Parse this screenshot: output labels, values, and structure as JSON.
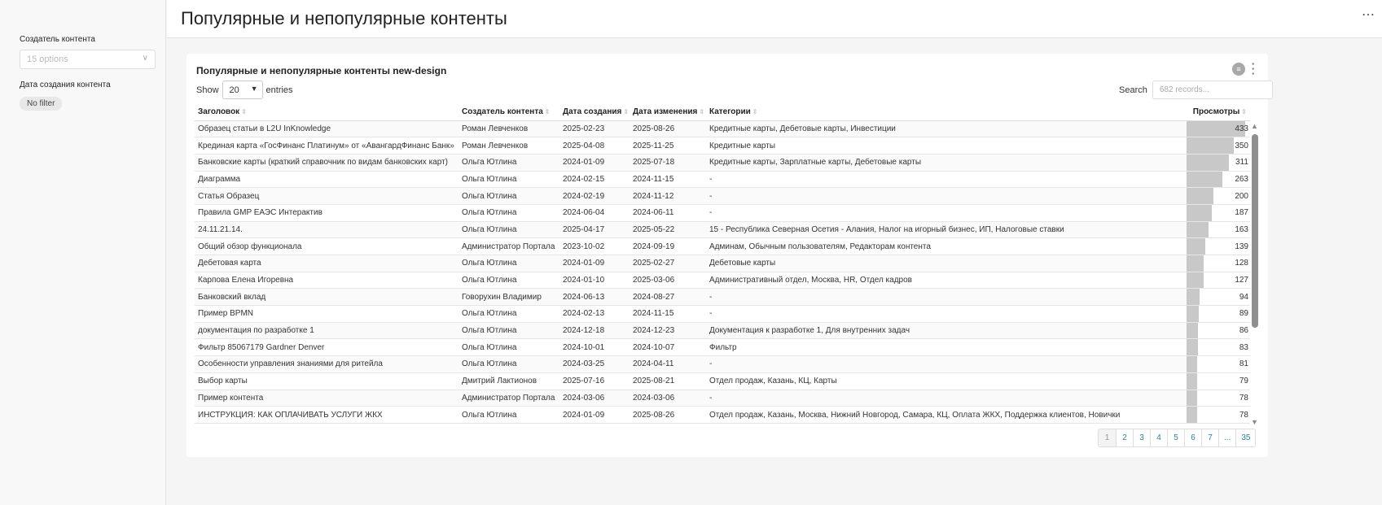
{
  "header": {
    "title": "Популярные и непопулярные контенты",
    "more_icon": "⋯"
  },
  "sidebar": {
    "creator_label": "Создатель контента",
    "creator_placeholder": "15 options",
    "date_label": "Дата создания контента",
    "date_chip": "No filter"
  },
  "card": {
    "title": "Популярные и непопулярные контенты new-design",
    "show_label": "Show",
    "entries_label": "entries",
    "page_size": "20",
    "search_label": "Search",
    "search_placeholder": "682 records..."
  },
  "table": {
    "columns": [
      "Заголовок",
      "Создатель контента",
      "Дата создания",
      "Дата изменения",
      "Категории",
      "Просмотры"
    ],
    "max_views": 433,
    "rows": [
      [
        "Образец статьи в L2U InKnowledge",
        "Роман Левченков",
        "2025-02-23",
        "2025-08-26",
        "Кредитные карты, Дебетовые карты, Инвестиции",
        433
      ],
      [
        "Крединая карта «ГосФинанс Платинум» от «АвангардФинанс Банк»",
        "Роман Левченков",
        "2025-04-08",
        "2025-11-25",
        "Кредитные карты",
        350
      ],
      [
        "Банковские карты (краткий справочник по видам банковских карт)",
        "Ольга Ютлина",
        "2024-01-09",
        "2025-07-18",
        "Кредитные карты, Зарплатные карты, Дебетовые карты",
        311
      ],
      [
        "Диаграмма",
        "Ольга Ютлина",
        "2024-02-15",
        "2024-11-15",
        "-",
        263
      ],
      [
        "Статья Образец",
        "Ольга Ютлина",
        "2024-02-19",
        "2024-11-12",
        "-",
        200
      ],
      [
        "Правила GMP ЕАЭС Интерактив",
        "Ольга Ютлина",
        "2024-06-04",
        "2024-06-11",
        "-",
        187
      ],
      [
        "24.11.21.14.",
        "Ольга Ютлина",
        "2025-04-17",
        "2025-05-22",
        "15 - Республика Северная Осетия - Алания, Налог на игорный бизнес, ИП, Налоговые ставки",
        163
      ],
      [
        "Общий обзор функционала",
        "Администратор Портала",
        "2023-10-02",
        "2024-09-19",
        "Админам, Обычным пользователям, Редакторам контента",
        139
      ],
      [
        "Дебетовая карта",
        "Ольга Ютлина",
        "2024-01-09",
        "2025-02-27",
        "Дебетовые карты",
        128
      ],
      [
        "Карпова Елена Игоревна",
        "Ольга Ютлина",
        "2024-01-10",
        "2025-03-06",
        "Административный отдел, Москва, HR, Отдел кадров",
        127
      ],
      [
        "Банковский вклад",
        "Говорухин Владимир",
        "2024-06-13",
        "2024-08-27",
        "-",
        94
      ],
      [
        "Пример BPMN",
        "Ольга Ютлина",
        "2024-02-13",
        "2024-11-15",
        "-",
        89
      ],
      [
        "документация по разработке 1",
        "Ольга Ютлина",
        "2024-12-18",
        "2024-12-23",
        "Документация к разработке 1, Для внутренних задач",
        86
      ],
      [
        "Фильтр 85067179 Gardner Denver",
        "Ольга Ютлина",
        "2024-10-01",
        "2024-10-07",
        "Фильтр",
        83
      ],
      [
        "Особенности управления знаниями для ритейла",
        "Ольга Ютлина",
        "2024-03-25",
        "2024-04-11",
        "-",
        81
      ],
      [
        "Выбор карты",
        "Дмитрий Лактионов",
        "2025-07-16",
        "2025-08-21",
        "Отдел продаж, Казань, КЦ, Карты",
        79
      ],
      [
        "Пример контента",
        "Администратор Портала",
        "2024-03-06",
        "2024-03-06",
        "-",
        78
      ],
      [
        "ИНСТРУКЦИЯ: КАК ОПЛАЧИВАТЬ УСЛУГИ ЖКХ",
        "Ольга Ютлина",
        "2024-01-09",
        "2025-08-26",
        "Отдел продаж, Казань, Москва, Нижний Новгород, Самара, КЦ, Оплата ЖКХ, Поддержка клиентов, Новички",
        78
      ]
    ]
  },
  "pagination": [
    "1",
    "2",
    "3",
    "4",
    "5",
    "6",
    "7",
    "...",
    "35"
  ],
  "colors": {
    "bar": "#c8c8c8",
    "link": "#2a7fa5",
    "scrollbar": "#8f8f8f"
  }
}
